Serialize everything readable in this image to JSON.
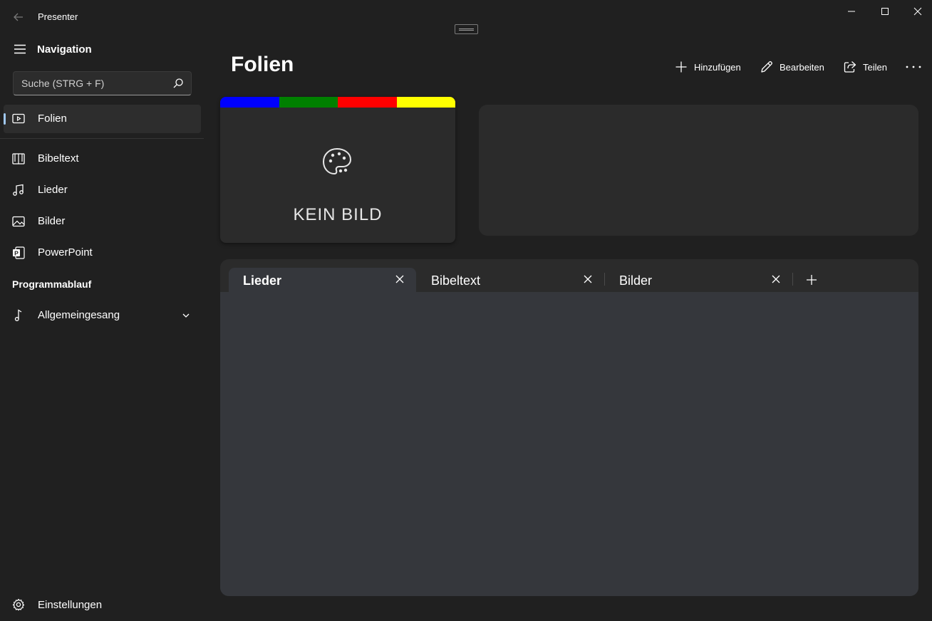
{
  "app": {
    "title": "Presenter"
  },
  "sidebar": {
    "title": "Navigation",
    "search_placeholder": "Suche (STRG + F)",
    "items": [
      {
        "label": "Folien",
        "icon": "slideshow-icon",
        "selected": true
      },
      {
        "label": "Bibeltext",
        "icon": "book-icon"
      },
      {
        "label": "Lieder",
        "icon": "music-note-icon"
      },
      {
        "label": "Bilder",
        "icon": "image-icon"
      },
      {
        "label": "PowerPoint",
        "icon": "powerpoint-icon"
      }
    ],
    "section_header": "Programmablauf",
    "program_items": [
      {
        "label": "Allgemeingesang",
        "icon": "music-note-single-icon"
      }
    ],
    "settings_label": "Einstellungen"
  },
  "main": {
    "page_title": "Folien",
    "commands": {
      "add": "Hinzufügen",
      "edit": "Bearbeiten",
      "share": "Teilen"
    },
    "slide_card": {
      "colors": [
        "#0000ff",
        "#008000",
        "#ff0000",
        "#ffff00"
      ],
      "placeholder_text": "KEIN BILD"
    },
    "tabs": [
      {
        "label": "Lieder",
        "active": true
      },
      {
        "label": "Bibeltext"
      },
      {
        "label": "Bilder"
      }
    ]
  },
  "colors": {
    "background": "#202020",
    "card": "#2b2b2b",
    "tab_content": "#35373c",
    "accent_indicator": "#a0c8f0"
  }
}
